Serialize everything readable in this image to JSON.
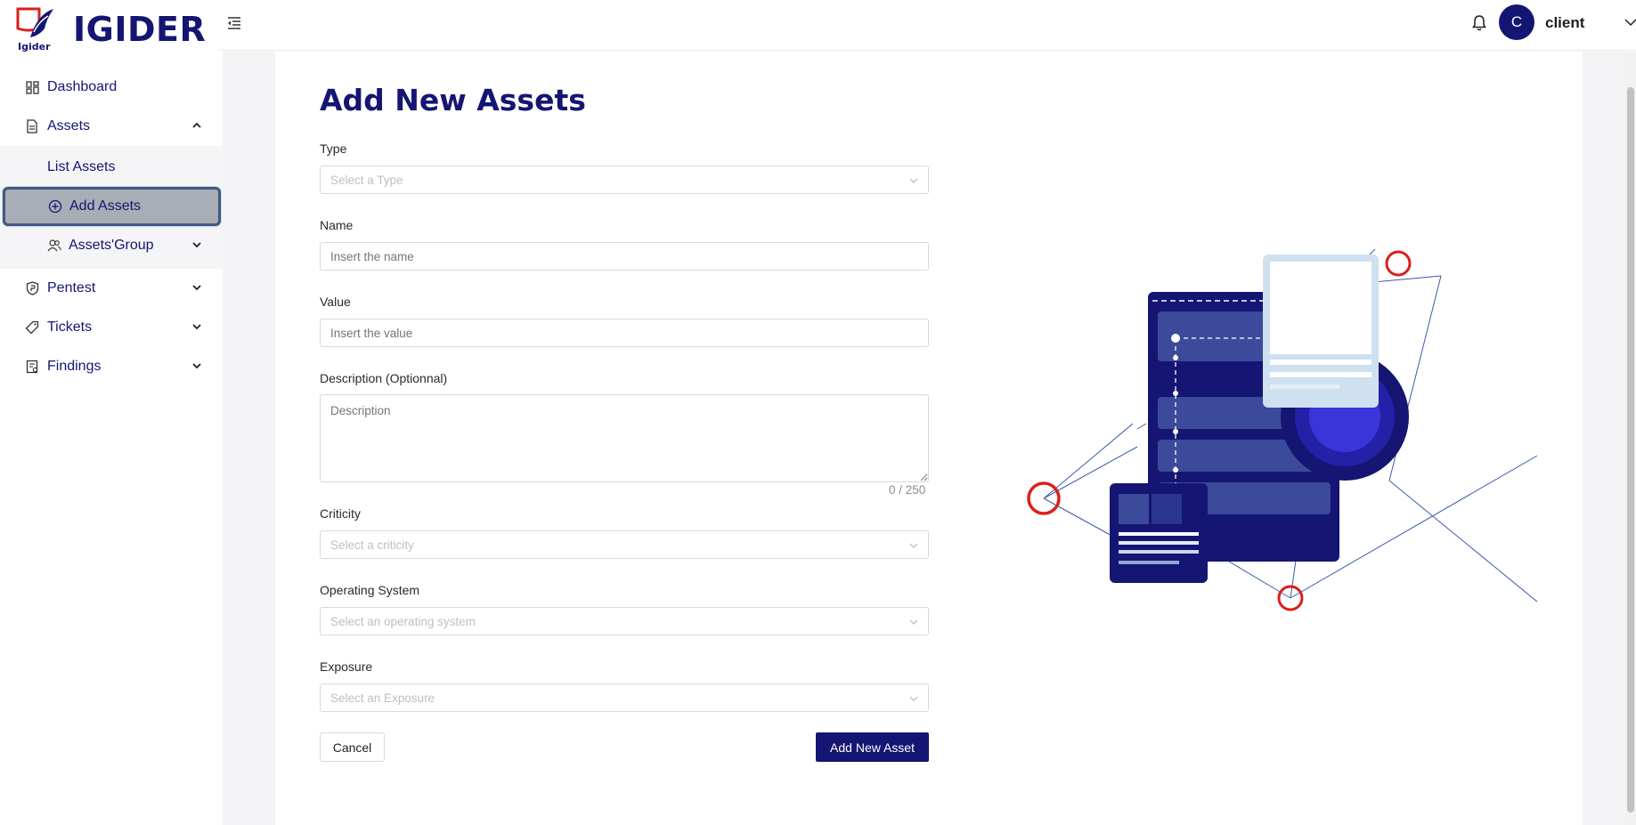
{
  "brand": {
    "name": "IGIDER",
    "logo_tagline": "Igider"
  },
  "sidebar": {
    "items": [
      {
        "label": "Dashboard",
        "icon": "dashboard-icon"
      },
      {
        "label": "Assets",
        "icon": "document-icon",
        "expanded": true,
        "children": [
          {
            "label": "List Assets"
          },
          {
            "label": "Add Assets",
            "icon": "plus-circle-icon",
            "active": true
          },
          {
            "label": "Assets'Group",
            "icon": "users-icon"
          }
        ]
      },
      {
        "label": "Pentest",
        "icon": "shield-icon"
      },
      {
        "label": "Tickets",
        "icon": "tag-icon"
      },
      {
        "label": "Findings",
        "icon": "report-icon"
      }
    ]
  },
  "header": {
    "user_initial": "C",
    "user_name": "client"
  },
  "form": {
    "title": "Add New Assets",
    "type": {
      "label": "Type",
      "placeholder": "Select a Type"
    },
    "name": {
      "label": "Name",
      "placeholder": "Insert the name"
    },
    "value": {
      "label": "Value",
      "placeholder": "Insert the value"
    },
    "description": {
      "label": "Description (Optionnal)",
      "placeholder": "Description",
      "counter": "0 / 250"
    },
    "criticity": {
      "label": "Criticity",
      "placeholder": "Select a criticity"
    },
    "os": {
      "label": "Operating System",
      "placeholder": "Select an operating system"
    },
    "exposure": {
      "label": "Exposure",
      "placeholder": "Select an Exposure"
    },
    "cancel_label": "Cancel",
    "submit_label": "Add New Asset"
  },
  "colors": {
    "primary": "#151573",
    "accent_red": "#d9201a",
    "active_bg": "#a9adb5"
  }
}
